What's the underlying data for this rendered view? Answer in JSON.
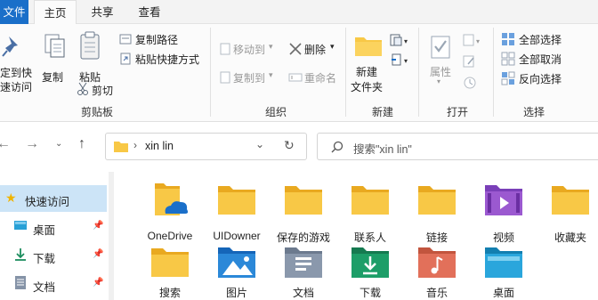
{
  "tabs": {
    "file": "文件",
    "home": "主页",
    "share": "共享",
    "view": "查看"
  },
  "ribbon": {
    "clipboard": {
      "pin_label_1": "定到快",
      "pin_label_2": "速访问",
      "copy": "复制",
      "paste": "粘贴",
      "copy_path": "复制路径",
      "paste_shortcut": "粘贴快捷方式",
      "cut": "剪切",
      "group": "剪贴板"
    },
    "organize": {
      "move_to": "移动到",
      "delete": "删除",
      "copy_to": "复制到",
      "rename": "重命名",
      "group": "组织"
    },
    "new": {
      "new_folder_1": "新建",
      "new_folder_2": "文件夹",
      "group": "新建"
    },
    "open": {
      "properties": "属性",
      "group": "打开"
    },
    "select": {
      "select_all": "全部选择",
      "select_none": "全部取消",
      "invert": "反向选择",
      "group": "选择"
    }
  },
  "address": {
    "path": "xin lin",
    "search_placeholder": "搜索\"xin lin\""
  },
  "sidebar": {
    "items": [
      {
        "label": "快速访问",
        "icon": "star-icon"
      },
      {
        "label": "桌面",
        "icon": "desktop-icon",
        "pinned": true
      },
      {
        "label": "下载",
        "icon": "download-icon",
        "pinned": true
      },
      {
        "label": "文档",
        "icon": "document-icon",
        "pinned": true
      }
    ]
  },
  "items": [
    {
      "label": "OneDrive",
      "icon": "onedrive-folder-icon"
    },
    {
      "label": "UIDowner",
      "icon": "folder-icon"
    },
    {
      "label": "保存的游戏",
      "icon": "folder-icon"
    },
    {
      "label": "联系人",
      "icon": "folder-icon"
    },
    {
      "label": "链接",
      "icon": "folder-icon"
    },
    {
      "label": "视频",
      "icon": "video-folder-icon"
    },
    {
      "label": "收藏夹",
      "icon": "folder-icon"
    },
    {
      "label": "搜索",
      "icon": "folder-icon"
    },
    {
      "label": "图片",
      "icon": "pictures-folder-icon"
    },
    {
      "label": "文档",
      "icon": "documents-folder-icon"
    },
    {
      "label": "下载",
      "icon": "downloads-folder-icon"
    },
    {
      "label": "音乐",
      "icon": "music-folder-icon"
    },
    {
      "label": "桌面",
      "icon": "desktop-folder-icon"
    }
  ],
  "colors": {
    "accent": "#1a6fc9",
    "folder": "#f8c846",
    "folder_dark": "#e9a920"
  }
}
